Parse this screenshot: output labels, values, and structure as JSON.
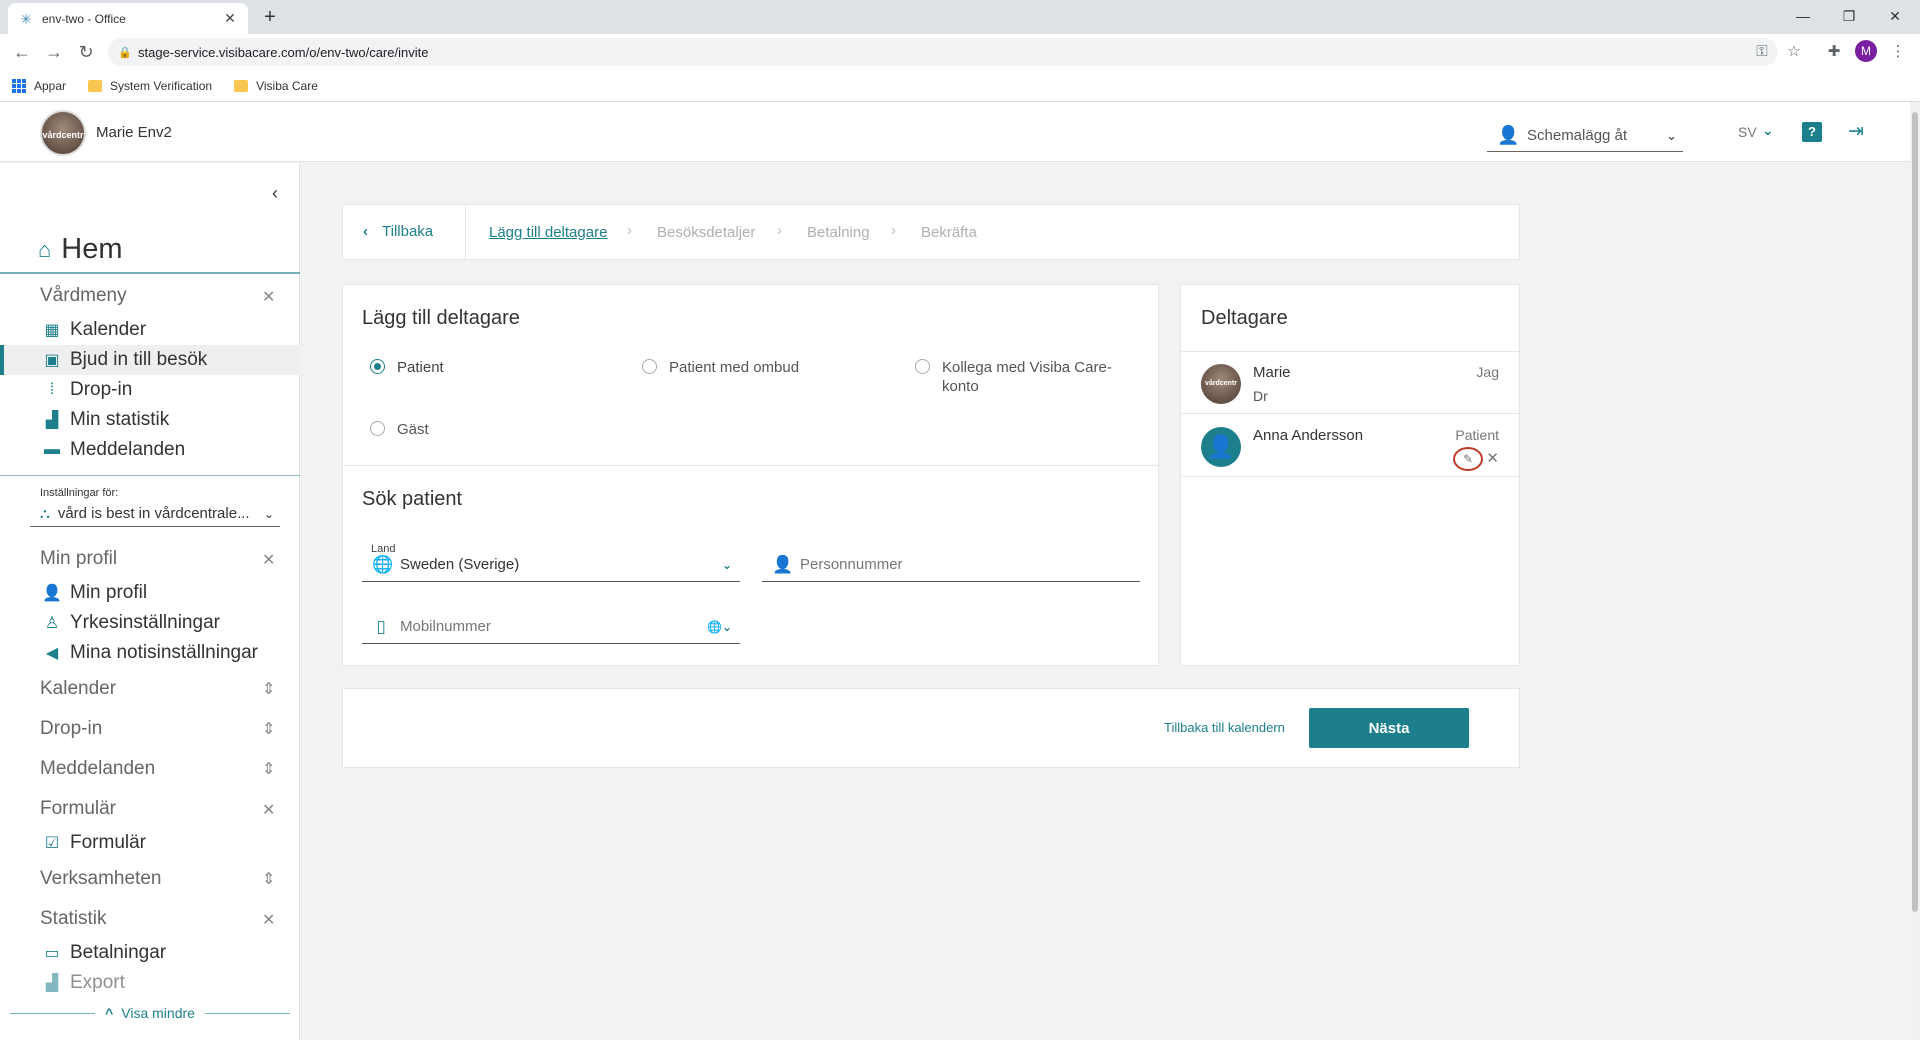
{
  "browser": {
    "tab_title": "env-two - Office",
    "new_tab": "+",
    "url": "stage-service.visibacare.com/o/env-two/care/invite",
    "profile_initial": "M",
    "bookmarks": [
      "Appar",
      "System Verification",
      "Visiba Care"
    ]
  },
  "header": {
    "user_name": "Marie Env2",
    "avatar_text": "vårdcentr",
    "schedule_label": "Schemalägg åt",
    "language": "SV",
    "help": "?"
  },
  "sidebar": {
    "home": "Hem",
    "sections": {
      "vardmeny": {
        "title": "Vårdmeny",
        "items": [
          "Kalender",
          "Bjud in till besök",
          "Drop-in",
          "Min statistik",
          "Meddelanden"
        ]
      },
      "settings_for_label": "Inställningar för:",
      "settings_for_value": "vård is best in vårdcentrale...",
      "min_profil": {
        "title": "Min profil",
        "items": [
          "Min profil",
          "Yrkesinställningar",
          "Mina notisinställningar"
        ]
      },
      "kalender": {
        "title": "Kalender"
      },
      "drop_in": {
        "title": "Drop-in"
      },
      "meddelanden": {
        "title": "Meddelanden"
      },
      "formular": {
        "title": "Formulär",
        "items": [
          "Formulär"
        ]
      },
      "verksamheten": {
        "title": "Verksamheten"
      },
      "statistik": {
        "title": "Statistik",
        "items": [
          "Betalningar",
          "Export"
        ]
      }
    },
    "show_less": "Visa mindre"
  },
  "breadcrumb": {
    "back": "Tillbaka",
    "steps": [
      "Lägg till deltagare",
      "Besöksdetaljer",
      "Betalning",
      "Bekräfta"
    ]
  },
  "add_participant": {
    "title": "Lägg till deltagare",
    "options": [
      "Patient",
      "Patient med ombud",
      "Kollega med Visiba Care-konto",
      "Gäst"
    ],
    "selected": "Patient"
  },
  "search_patient": {
    "title": "Sök patient",
    "country_label": "Land",
    "country_value": "Sweden (Sverige)",
    "personnummer_placeholder": "Personnummer",
    "mobile_placeholder": "Mobilnummer"
  },
  "participants": {
    "title": "Deltagare",
    "list": [
      {
        "name": "Marie",
        "sub": "Dr",
        "role": "Jag",
        "avatar_text": "vårdcentr"
      },
      {
        "name": "Anna Andersson",
        "sub": "",
        "role": "Patient"
      }
    ]
  },
  "footer": {
    "back_to_calendar": "Tillbaka till kalendern",
    "next": "Nästa"
  },
  "colors": {
    "accent": "#1d7f8c",
    "highlight_ring": "#c0392b"
  },
  "icons": [
    "home-icon",
    "calendar-icon",
    "invite-icon",
    "drop-in-icon",
    "stats-icon",
    "message-icon",
    "org-icon",
    "person-icon",
    "badge-icon",
    "megaphone-icon",
    "checklist-icon",
    "card-icon",
    "export-icon",
    "globe-icon",
    "phone-icon",
    "pencil-icon",
    "close-icon",
    "help-icon",
    "logout-icon"
  ]
}
